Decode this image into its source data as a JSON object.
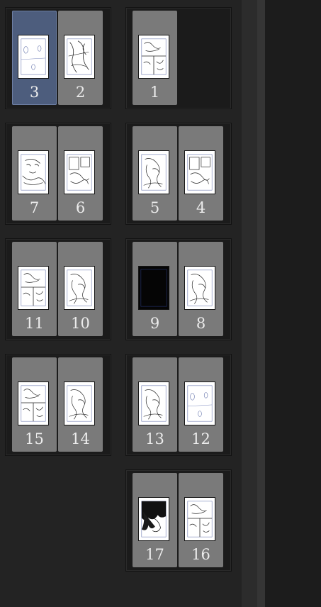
{
  "pages": {
    "p1": {
      "number": "1",
      "thumb": "panels-sketch",
      "selected": false
    },
    "p2": {
      "number": "2",
      "thumb": "character-sketch",
      "selected": false
    },
    "p3": {
      "number": "3",
      "thumb": "balloon-layout",
      "selected": true
    },
    "p4": {
      "number": "4",
      "thumb": "panel-sketch",
      "selected": false
    },
    "p5": {
      "number": "5",
      "thumb": "figure-sketch",
      "selected": false
    },
    "p6": {
      "number": "6",
      "thumb": "panel-sketch",
      "selected": false
    },
    "p7": {
      "number": "7",
      "thumb": "face-sketch",
      "selected": false
    },
    "p8": {
      "number": "8",
      "thumb": "figure-sketch",
      "selected": false
    },
    "p9": {
      "number": "9",
      "thumb": "black-page",
      "selected": false
    },
    "p10": {
      "number": "10",
      "thumb": "figure-sketch",
      "selected": false
    },
    "p11": {
      "number": "11",
      "thumb": "panels-sketch",
      "selected": false
    },
    "p12": {
      "number": "12",
      "thumb": "balloon-layout",
      "selected": false
    },
    "p13": {
      "number": "13",
      "thumb": "figure-sketch",
      "selected": false
    },
    "p14": {
      "number": "14",
      "thumb": "figure-sketch",
      "selected": false
    },
    "p15": {
      "number": "15",
      "thumb": "panels-sketch",
      "selected": false
    },
    "p16": {
      "number": "16",
      "thumb": "panels-sketch",
      "selected": false
    },
    "p17": {
      "number": "17",
      "thumb": "dark-figure",
      "selected": false
    }
  }
}
